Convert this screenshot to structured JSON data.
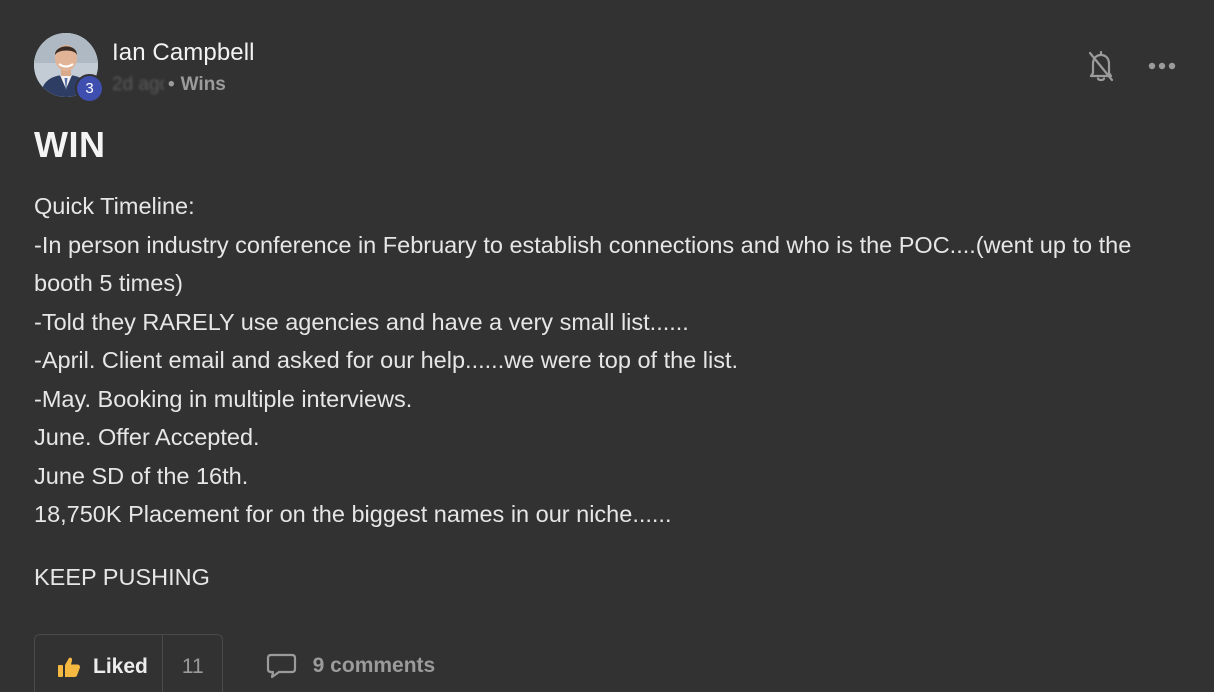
{
  "post": {
    "author": "Ian Campbell",
    "level": "3",
    "time_ago": "2d ago",
    "category": "Wins",
    "title": "WIN",
    "body_lines": [
      "Quick Timeline:",
      "-In person industry conference in February to establish connections and who is the POC....(went up to the booth 5 times)",
      "-Told they RARELY use agencies and have a very small list......",
      "-April. Client email and asked for our help......we were top of the list.",
      "-May. Booking in multiple interviews.",
      "June. Offer Accepted.",
      "June SD of the 16th.",
      "18,750K Placement for on the biggest names in our niche......"
    ],
    "closing": "KEEP PUSHING",
    "separator": "•"
  },
  "actions": {
    "like_label": "Liked",
    "like_count": "11",
    "comments_label": "9 comments"
  },
  "icons": {
    "bell": "bell-off-icon",
    "more": "more-horizontal-icon",
    "like": "thumbs-up-icon",
    "comment": "comment-icon"
  },
  "colors": {
    "background": "#323232",
    "badge": "#3f4fb0",
    "like_icon": "#f5b942"
  }
}
